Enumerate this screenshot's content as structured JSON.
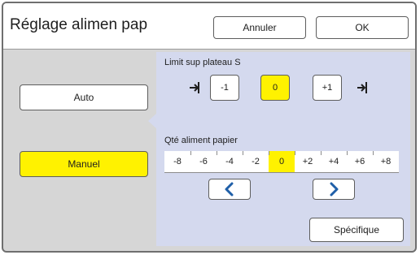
{
  "header": {
    "title": "Réglage alimen pap",
    "cancel_label": "Annuler",
    "ok_label": "OK"
  },
  "modes": {
    "auto_label": "Auto",
    "manual_label": "Manuel",
    "selected": "Manuel"
  },
  "tray_limit": {
    "label": "Limit sup plateau S",
    "options": [
      "-1",
      "0",
      "+1"
    ],
    "selected": "0"
  },
  "feed_amount": {
    "label": "Qté aliment papier",
    "scale": [
      "-8",
      "-6",
      "-4",
      "-2",
      "0",
      "+2",
      "+4",
      "+6",
      "+8"
    ],
    "selected": "0"
  },
  "specific_label": "Spécifique",
  "colors": {
    "selected": "#fff200",
    "panel": "#d4d9ee",
    "arrow": "#1f5fa8"
  }
}
